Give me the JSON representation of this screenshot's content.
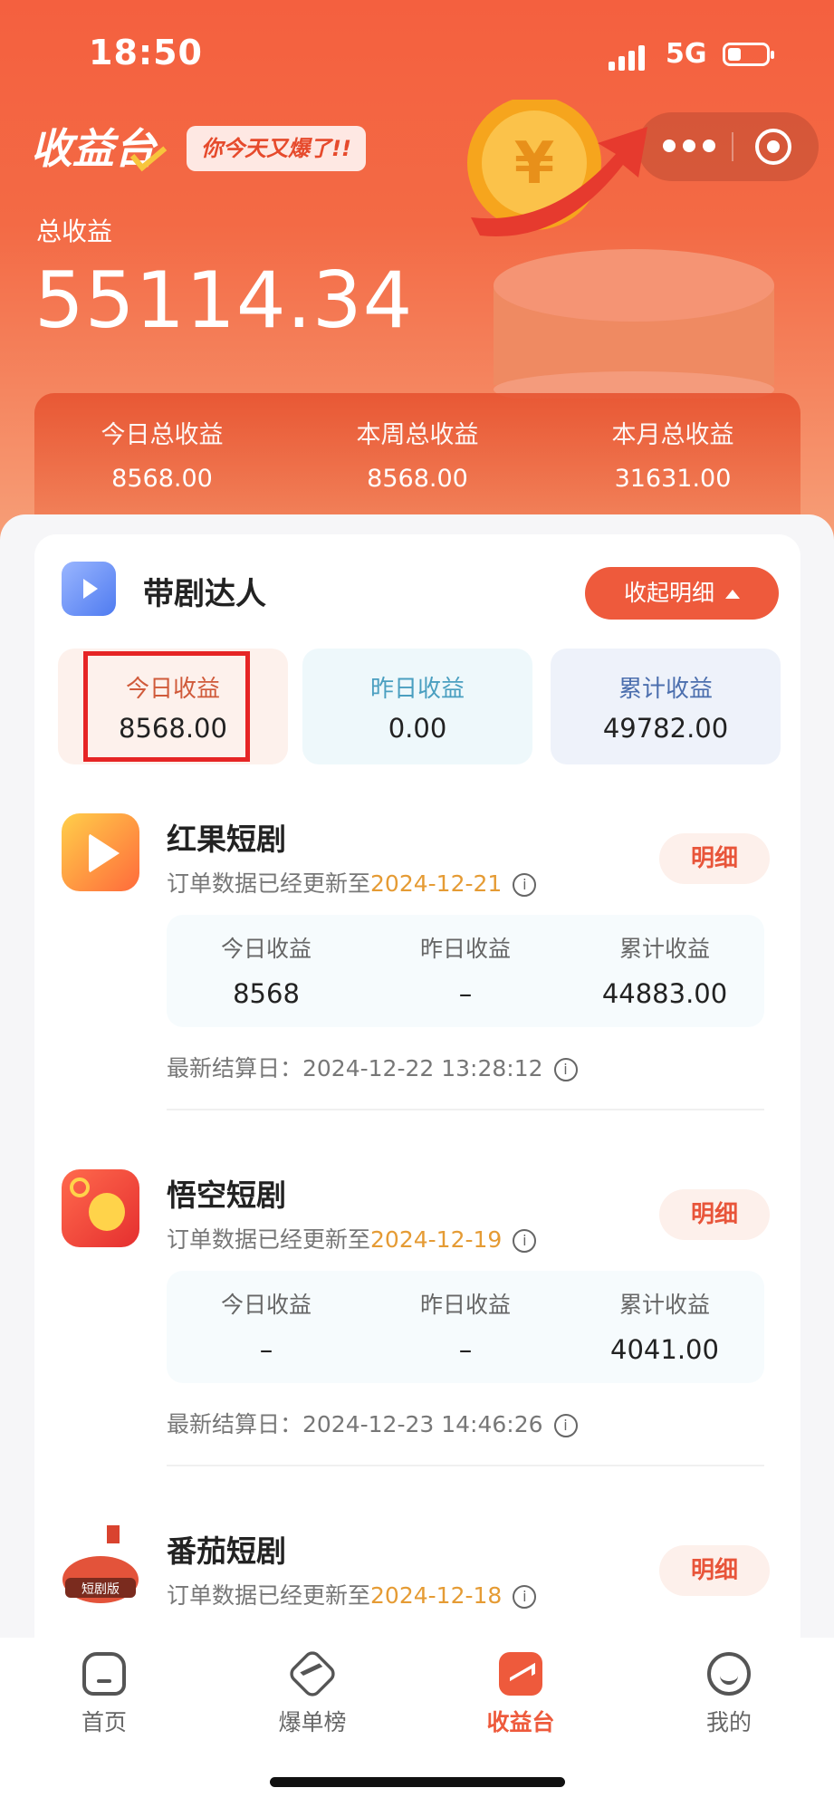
{
  "status_bar": {
    "time": "18:50",
    "network": "5G"
  },
  "header": {
    "title": "收益台",
    "slogan": "你今天又爆了!!",
    "total_label": "总收益",
    "total_value": "55114.34"
  },
  "summary": [
    {
      "label": "今日总收益",
      "value": "8568.00"
    },
    {
      "label": "本周总收益",
      "value": "8568.00"
    },
    {
      "label": "本月总收益",
      "value": "31631.00"
    }
  ],
  "section": {
    "title": "带剧达人",
    "collapse_label": "收起明细",
    "stats": [
      {
        "label": "今日收益",
        "value": "8568.00"
      },
      {
        "label": "昨日收益",
        "value": "0.00"
      },
      {
        "label": "累计收益",
        "value": "49782.00"
      }
    ]
  },
  "platforms": [
    {
      "name": "红果短剧",
      "update_prefix": "订单数据已经更新至",
      "update_date": "2024-12-21",
      "detail_label": "明细",
      "stats": [
        {
          "label": "今日收益",
          "value": "8568"
        },
        {
          "label": "昨日收益",
          "value": "–"
        },
        {
          "label": "累计收益",
          "value": "44883.00"
        }
      ],
      "settle": "最新结算日：2024-12-22 13:28:12"
    },
    {
      "name": "悟空短剧",
      "update_prefix": "订单数据已经更新至",
      "update_date": "2024-12-19",
      "detail_label": "明细",
      "stats": [
        {
          "label": "今日收益",
          "value": "–"
        },
        {
          "label": "昨日收益",
          "value": "–"
        },
        {
          "label": "累计收益",
          "value": "4041.00"
        }
      ],
      "settle": "最新结算日：2024-12-23 14:46:26"
    },
    {
      "name": "番茄短剧",
      "icon_text": "短剧版",
      "update_prefix": "订单数据已经更新至",
      "update_date": "2024-12-18",
      "detail_label": "明细"
    }
  ],
  "tabbar": [
    {
      "label": "首页",
      "icon": "home-icon"
    },
    {
      "label": "爆单榜",
      "icon": "hot-list-icon"
    },
    {
      "label": "收益台",
      "icon": "income-icon",
      "active": true
    },
    {
      "label": "我的",
      "icon": "profile-icon"
    }
  ],
  "colors": {
    "accent": "#ee5a3c",
    "date": "#e59b34",
    "highlight_border": "#e62525"
  }
}
